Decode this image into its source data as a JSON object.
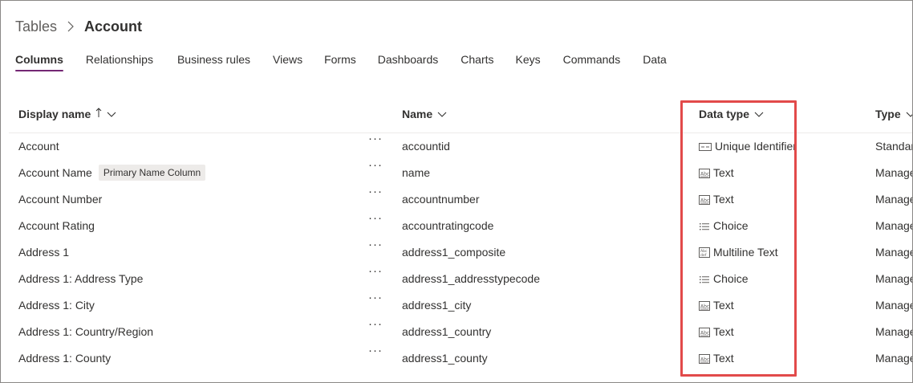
{
  "breadcrumb": {
    "parent": "Tables",
    "current": "Account"
  },
  "tabs": [
    {
      "label": "Columns",
      "active": true
    },
    {
      "label": "Relationships"
    },
    {
      "label": "Business rules"
    },
    {
      "label": "Views"
    },
    {
      "label": "Forms"
    },
    {
      "label": "Dashboards"
    },
    {
      "label": "Charts"
    },
    {
      "label": "Keys"
    },
    {
      "label": "Commands"
    },
    {
      "label": "Data"
    }
  ],
  "columns": {
    "display_name": "Display name",
    "name": "Name",
    "data_type": "Data type",
    "type": "Type"
  },
  "colors": {
    "accent": "#742774",
    "highlight": "#e24a4a",
    "badge_bg": "#edebe9"
  },
  "rows": [
    {
      "display": "Account",
      "badge": "",
      "more": "···",
      "name": "accountid",
      "dtype_icon": "unique-identifier-icon",
      "dtype": "Unique Identifier",
      "type": "Standar"
    },
    {
      "display": "Account Name",
      "badge": "Primary Name Column",
      "more": "···",
      "name": "name",
      "dtype_icon": "text-icon",
      "dtype": "Text",
      "type": "Manage"
    },
    {
      "display": "Account Number",
      "badge": "",
      "more": "···",
      "name": "accountnumber",
      "dtype_icon": "text-icon",
      "dtype": "Text",
      "type": "Manage"
    },
    {
      "display": "Account Rating",
      "badge": "",
      "more": "···",
      "name": "accountratingcode",
      "dtype_icon": "choice-icon",
      "dtype": "Choice",
      "type": "Manage"
    },
    {
      "display": "Address 1",
      "badge": "",
      "more": "···",
      "name": "address1_composite",
      "dtype_icon": "multiline-text-icon",
      "dtype": "Multiline Text",
      "type": "Manage"
    },
    {
      "display": "Address 1: Address Type",
      "badge": "",
      "more": "···",
      "name": "address1_addresstypecode",
      "dtype_icon": "choice-icon",
      "dtype": "Choice",
      "type": "Manage"
    },
    {
      "display": "Address 1: City",
      "badge": "",
      "more": "···",
      "name": "address1_city",
      "dtype_icon": "text-icon",
      "dtype": "Text",
      "type": "Manage"
    },
    {
      "display": "Address 1: Country/Region",
      "badge": "",
      "more": "···",
      "name": "address1_country",
      "dtype_icon": "text-icon",
      "dtype": "Text",
      "type": "Manage"
    },
    {
      "display": "Address 1: County",
      "badge": "",
      "more": "···",
      "name": "address1_county",
      "dtype_icon": "text-icon",
      "dtype": "Text",
      "type": "Manage"
    }
  ]
}
